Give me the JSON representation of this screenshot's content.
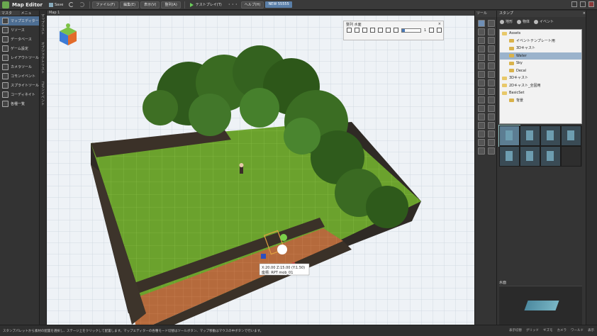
{
  "titlebar": {
    "app_title": "Map Editor",
    "save_label": "Save",
    "menus": [
      "ファイル(F)",
      "編集(E)",
      "表示(V)",
      "整列(A)"
    ],
    "test_play_label": "テストプレイ(T)",
    "more_label": "・・・",
    "help_label": "ヘルプ(H)",
    "project_label": "NEW 55555"
  },
  "left_panel": {
    "tabs": [
      "マスタ",
      "メニュ"
    ],
    "items": [
      {
        "label": "マップエディター",
        "selected": true
      },
      {
        "label": "リソース",
        "selected": false
      },
      {
        "label": "データベース",
        "selected": false
      },
      {
        "label": "ゲーム設定",
        "selected": false
      },
      {
        "label": "レイアウトツール",
        "selected": false
      },
      {
        "label": "カメラツール",
        "selected": false
      },
      {
        "label": "コモンイベント",
        "selected": false
      },
      {
        "label": "スプライトツール",
        "selected": false
      },
      {
        "label": "コーディネイト",
        "selected": false
      },
      {
        "label": "各種一覧",
        "selected": false
      }
    ],
    "strip1_label": "マップリスト",
    "strip2_label": "オブジェクトリスト",
    "strip3_label": "コモンイベント"
  },
  "map": {
    "tab_label": "Map 1",
    "tooltip_line1": "X:20.00 Z:15.00 (Y:1.50)",
    "tooltip_line2": "座標: RPT mob_01"
  },
  "float_toolbar": {
    "title": "整列 水面",
    "value": "1"
  },
  "tool_column": {
    "header": "ツール"
  },
  "right_panel": {
    "header": "スタンプ",
    "tabs": [
      "地形",
      "物体",
      "イベント"
    ],
    "tree": [
      {
        "label": "Assets",
        "indent": 0,
        "selected": false
      },
      {
        "label": "イベントテンプレート用",
        "indent": 1,
        "selected": false
      },
      {
        "label": "3Dキャスト",
        "indent": 1,
        "selected": false
      },
      {
        "label": "Water",
        "indent": 1,
        "selected": true
      },
      {
        "label": "Sky",
        "indent": 1,
        "selected": false
      },
      {
        "label": "Decal",
        "indent": 1,
        "selected": false
      },
      {
        "label": "3Dキャスト",
        "indent": 0,
        "selected": false
      },
      {
        "label": "2Dキャスト_全固用",
        "indent": 0,
        "selected": false
      },
      {
        "label": "BasicSet",
        "indent": 0,
        "selected": false
      },
      {
        "label": "背景",
        "indent": 1,
        "selected": false
      }
    ],
    "preview_label": "水面"
  },
  "statusbar": {
    "message": "スタンプパレットから素材の配置を選択し、ステージ上をクリックして配置します。マップエディターの各種モード切替はツールボタン、マップ移動はマウスの中ボタンで行います。",
    "right_items": [
      "表示切替",
      "グリッド",
      "ギズモ",
      "カメラ",
      "ワールド",
      "表示"
    ]
  },
  "colors": {
    "accent": "#4d6e93",
    "grass": "#6aa02c",
    "path": "#b96d3e"
  }
}
